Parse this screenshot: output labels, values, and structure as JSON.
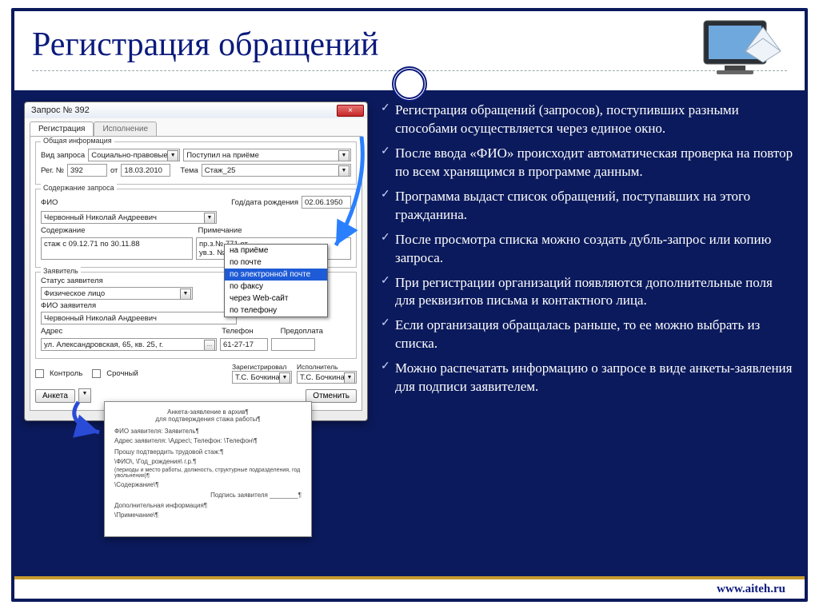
{
  "title": "Регистрация обращений",
  "footer_url": "www.aiteh.ru",
  "bullets": [
    "Регистрация обращений (запросов), поступивших разными способами осуществляется через единое  окно.",
    "После ввода «ФИО» происходит автоматическая проверка на повтор по всем хранящимся в программе данным.",
    "Программа выдаст список обращений, поступавших на этого гражданина.",
    "После просмотра списка можно создать дубль-запрос или копию запроса.",
    "При регистрации организаций появляются дополнительные поля для реквизитов письма и контактного лица.",
    "Если организация обращалась раньше, то ее можно выбрать из списка.",
    "Можно распечатать информацию о запросе в виде анкеты-заявления для подписи заявителем."
  ],
  "win": {
    "title": "Запрос № 392",
    "tabs": {
      "active": "Регистрация",
      "inactive": "Исполнение"
    },
    "group_general": "Общая информация",
    "labels": {
      "request_type": "Вид запроса",
      "reg_no": "Рег. №",
      "from": "от",
      "topic": "Тема",
      "received": "Поступил на приёме",
      "content_group": "Содержание запроса",
      "fio": "ФИО",
      "birth": "Год/дата рождения",
      "content": "Содержание",
      "note": "Примечание",
      "applicant_group": "Заявитель",
      "status": "Статус заявителя",
      "applicant_fio": "ФИО заявителя",
      "address": "Адрес",
      "phone": "Телефон",
      "prepay": "Предоплата",
      "control": "Контроль",
      "urgent": "Срочный",
      "registered_by": "Зарегистрировал",
      "executor": "Исполнитель",
      "anketa": "Анкета",
      "cancel": "Отменить"
    },
    "values": {
      "request_type": "Социально-правовые",
      "reg_no": "392",
      "date": "18.03.2010",
      "topic": "Стаж_25",
      "fio": "Червонный Николай Андреевич",
      "birth": "02.06.1950",
      "content": "стаж с 09.12.71 по 30.11.88",
      "note1": "пр.з.№ 771 от ...",
      "note2": "ув.з. № 596 от 29.11.88 г.",
      "status": "Физическое лицо",
      "applicant_fio": "Червонный Николай Андреевич",
      "address": "ул. Александровская, 65, кв. 25, г.",
      "phone": "61-27-17",
      "registered_by": "Т.С. Бочкина",
      "executor": "Т.С. Бочкина"
    },
    "popup": [
      "на приёме",
      "по почте",
      "по электронной почте",
      "по факсу",
      "через Web-сайт",
      "по телефону"
    ],
    "popup_selected": 2
  },
  "doc": {
    "title": "Анкета-заявление в архив¶",
    "subtitle": "для подтверждения стажа работы¶",
    "lines": [
      "ФИО заявителя: Заявитель¶",
      "Адрес заявителя: \\Адрес\\; Телефон: \\Телефон\\¶",
      "Прошу подтвердить трудовой стаж:¶",
      "\\ФИО\\, \\Год_рождения\\ г.р.¶",
      "(периоды и место работы, должность, структурные подразделения, год увольнения)¶",
      "\\Содержание\\¶",
      "Подпись заявителя ________¶",
      "Дополнительная информация¶",
      "\\Примечание\\¶"
    ]
  }
}
